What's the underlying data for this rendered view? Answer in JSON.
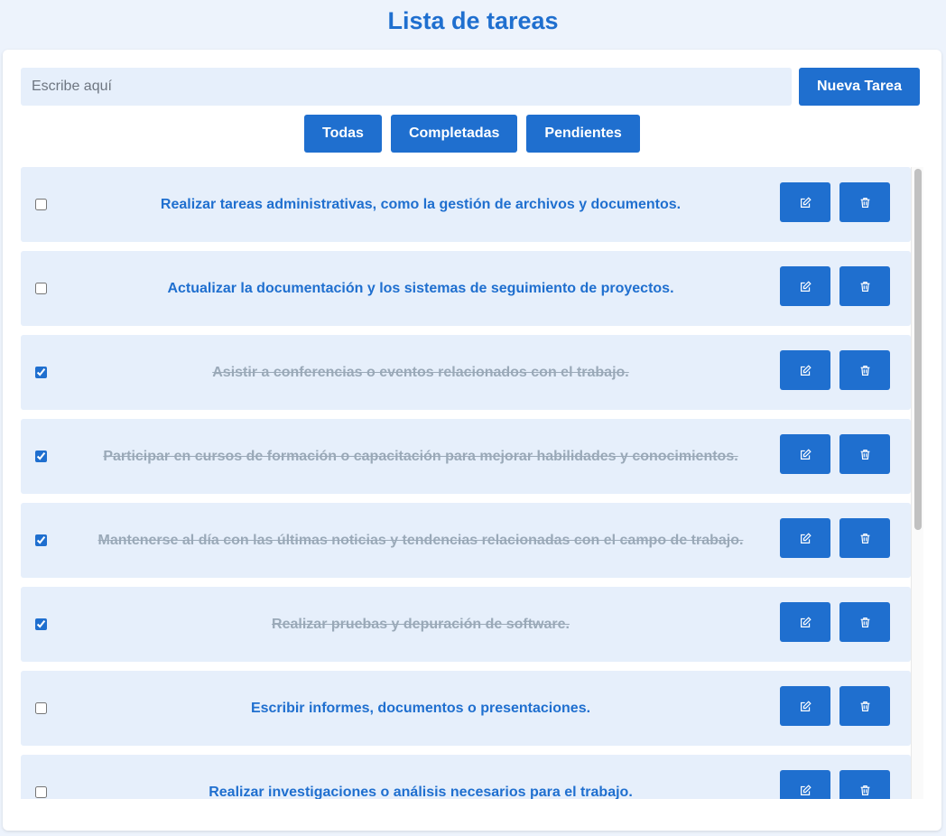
{
  "header": {
    "title": "Lista de tareas"
  },
  "input": {
    "placeholder": "Escribe aquí",
    "value": "",
    "add_label": "Nueva Tarea"
  },
  "filters": [
    {
      "label": "Todas"
    },
    {
      "label": "Completadas"
    },
    {
      "label": "Pendientes"
    }
  ],
  "tasks": [
    {
      "text": "Realizar tareas administrativas, como la gestión de archivos y documentos.",
      "done": false
    },
    {
      "text": "Actualizar la documentación y los sistemas de seguimiento de proyectos.",
      "done": false
    },
    {
      "text": "Asistir a conferencias o eventos relacionados con el trabajo.",
      "done": true
    },
    {
      "text": "Participar en cursos de formación o capacitación para mejorar habilidades y conocimientos.",
      "done": true
    },
    {
      "text": "Mantenerse al día con las últimas noticias y tendencias relacionadas con el campo de trabajo.",
      "done": true
    },
    {
      "text": "Realizar pruebas y depuración de software.",
      "done": true
    },
    {
      "text": "Escribir informes, documentos o presentaciones.",
      "done": false
    },
    {
      "text": "Realizar investigaciones o análisis necesarios para el trabajo.",
      "done": false
    }
  ],
  "icons": {
    "edit": "edit-icon",
    "delete": "trash-icon"
  },
  "colors": {
    "accent": "#1f6fcf",
    "item_bg": "#e6effb",
    "done_text": "#9aa9b8"
  }
}
